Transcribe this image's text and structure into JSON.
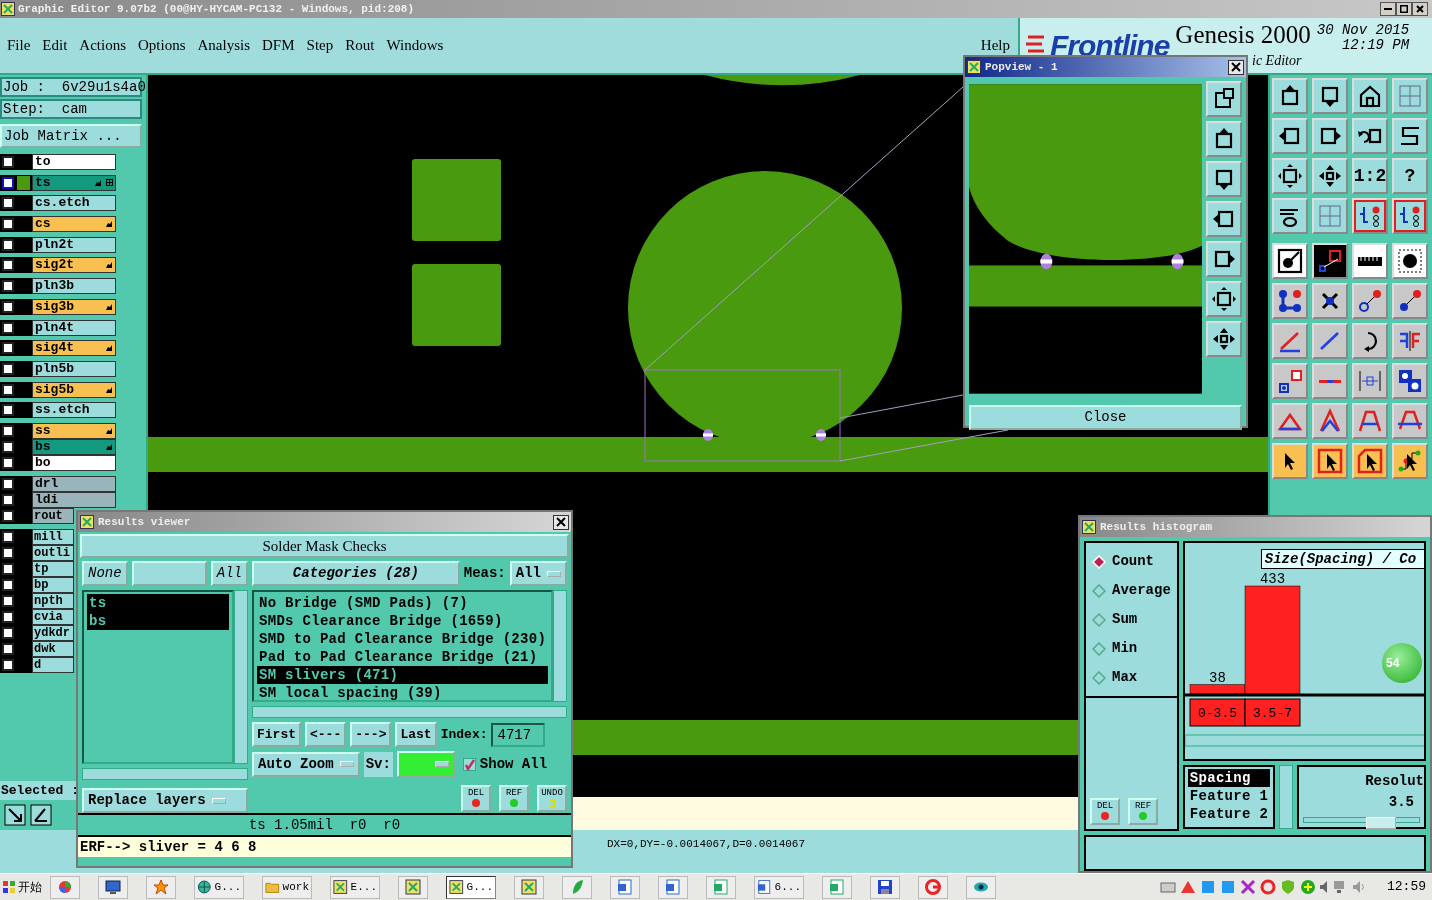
{
  "window": {
    "title": "Graphic Editor 9.07b2 (00@HY-HYCAM-PC132 - Windows, pid:208)"
  },
  "menu": [
    "File",
    "Edit",
    "Actions",
    "Options",
    "Analysis",
    "DFM",
    "Step",
    "Rout",
    "Windows"
  ],
  "help_menu": "Help",
  "brand": {
    "logo": "Frontline",
    "product": "Genesis 2000",
    "date": "30 Nov 2015",
    "time": "12:19 PM",
    "subtitle": "ic Editor"
  },
  "job": {
    "job": "Job :  6v29u1s4a0",
    "step": "Step:  cam",
    "matrix_button": "Job Matrix ..."
  },
  "layer_groups": [
    [
      {
        "name": "to",
        "color": "#ffffff",
        "affected": false,
        "work": false,
        "checked": false
      },
      {
        "name": "ts",
        "color": "#139a7e",
        "affected": true,
        "work": true,
        "checked": false
      },
      {
        "name": "cs.etch",
        "color": "#9ddcdc",
        "affected": false,
        "work": false,
        "checked": false
      },
      {
        "name": "cs",
        "color": "#f8c050",
        "affected": true,
        "work": false,
        "checked": false
      },
      {
        "name": "pln2t",
        "color": "#9ddcdc",
        "affected": false,
        "work": false,
        "checked": false
      },
      {
        "name": "sig2t",
        "color": "#f8c050",
        "affected": true,
        "work": false,
        "checked": false
      },
      {
        "name": "pln3b",
        "color": "#9ddcdc",
        "affected": false,
        "work": false,
        "checked": false
      },
      {
        "name": "sig3b",
        "color": "#f8c050",
        "affected": true,
        "work": false,
        "checked": false
      },
      {
        "name": "pln4t",
        "color": "#9ddcdc",
        "affected": false,
        "work": false,
        "checked": false
      },
      {
        "name": "sig4t",
        "color": "#f8c050",
        "affected": true,
        "work": false,
        "checked": false
      },
      {
        "name": "pln5b",
        "color": "#9ddcdc",
        "affected": false,
        "work": false,
        "checked": false
      },
      {
        "name": "sig5b",
        "color": "#f8c050",
        "affected": true,
        "work": false,
        "checked": false
      },
      {
        "name": "ss.etch",
        "color": "#9ddcdc",
        "affected": false,
        "work": false,
        "checked": false
      }
    ],
    [
      {
        "name": "ss",
        "color": "#f8c050",
        "affected": true,
        "work": false,
        "checked": false
      },
      {
        "name": "bs",
        "color": "#139a7e",
        "affected": true,
        "work": false,
        "checked": false
      },
      {
        "name": "bo",
        "color": "#ffffff",
        "affected": false,
        "work": false,
        "checked": false
      }
    ],
    [
      {
        "name": "drl",
        "color": "#9ab4bc",
        "affected": false,
        "work": false,
        "checked": false
      },
      {
        "name": "ldi",
        "color": "#9ab4bc",
        "affected": false,
        "work": false,
        "checked": false
      },
      {
        "name": "rout",
        "color": "#9ab4bc",
        "affected": false,
        "work": false,
        "checked": false
      }
    ],
    [
      {
        "name": "mill",
        "color": "#9ddcdc",
        "affected": false,
        "work": false,
        "checked": false
      },
      {
        "name": "outli",
        "color": "#9ddcdc",
        "affected": false,
        "work": false,
        "checked": false
      },
      {
        "name": "tp",
        "color": "#9ddcdc",
        "affected": false,
        "work": false,
        "checked": false
      },
      {
        "name": "bp",
        "color": "#9ddcdc",
        "affected": false,
        "work": false,
        "checked": false
      },
      {
        "name": "npth",
        "color": "#9ddcdc",
        "affected": false,
        "work": false,
        "checked": false
      },
      {
        "name": "cvia",
        "color": "#9ddcdc",
        "affected": false,
        "work": false,
        "checked": false
      },
      {
        "name": "ydkdr",
        "color": "#9ddcdc",
        "affected": false,
        "work": false,
        "checked": false
      },
      {
        "name": "dwk",
        "color": "#9ddcdc",
        "affected": false,
        "work": false,
        "checked": false
      },
      {
        "name": "d",
        "color": "#9ddcdc",
        "affected": false,
        "work": false,
        "checked": false
      }
    ]
  ],
  "selected_label": "Selected :",
  "toolbar_glyphs": [
    "1:2",
    "?"
  ],
  "status": "DX=0,DY=-0.0014067,D=0.0014067",
  "popview": {
    "title": "Popview - 1",
    "close": "Close"
  },
  "results_viewer": {
    "title": "Results viewer",
    "header": "Solder Mask Checks",
    "none_button": "None",
    "all_button": "All",
    "layers": [
      {
        "name": "ts",
        "selected": true
      },
      {
        "name": "bs",
        "selected": true
      }
    ],
    "categories_button": "Categories (28)",
    "meas_label": "Meas:",
    "meas_value": "All",
    "categories": [
      {
        "label": "No Bridge (SMD Pads) (7)",
        "selected": false
      },
      {
        "label": "SMDs Clearance Bridge (1659)",
        "selected": false
      },
      {
        "label": "SMD to Pad Clearance Bridge (230)",
        "selected": false
      },
      {
        "label": "Pad to Pad Clearance Bridge (21)",
        "selected": false
      },
      {
        "label": "SM slivers (471)",
        "selected": true
      },
      {
        "label": "SM local spacing (39)",
        "selected": false
      }
    ],
    "nav": [
      "First",
      "<---",
      "--->",
      "Last"
    ],
    "index_label": "Index:",
    "index_value": "4717",
    "zoom_mode": "Auto Zoom",
    "sv_label": "Sv:",
    "show_all": {
      "label": "Show All",
      "checked": true
    },
    "replace": "Replace layers",
    "actions": [
      {
        "label": "DEL",
        "kind": "delete"
      },
      {
        "label": "REF",
        "kind": "reference"
      },
      {
        "label": "UNDO",
        "kind": "undo"
      }
    ],
    "info": "ts 1.05mil  r0  r0",
    "erf": "ERF--> sliver = 4 6 8"
  },
  "histogram": {
    "title": "Results histogram",
    "modes": [
      {
        "label": "Count",
        "selected": true
      },
      {
        "label": "Average",
        "selected": false
      },
      {
        "label": "Sum",
        "selected": false
      },
      {
        "label": "Min",
        "selected": false
      },
      {
        "label": "Max",
        "selected": false
      }
    ],
    "chart_data": {
      "type": "bar",
      "title": "Size(Spacing) / Co",
      "categories": [
        "0-3.5",
        "3.5-7"
      ],
      "series": [
        {
          "color": "#ff2020",
          "values": [
            38,
            433
          ]
        }
      ],
      "data_labels": true
    },
    "fields": [
      {
        "label": "Spacing",
        "selected": true
      },
      {
        "label": "Feature 1",
        "selected": false
      },
      {
        "label": "Feature 2",
        "selected": false
      }
    ],
    "resolution": {
      "label": "Resolut",
      "value": "3.5",
      "level": 0.67
    },
    "actions": [
      {
        "label": "DEL",
        "kind": "delete"
      },
      {
        "label": "REF",
        "kind": "reference"
      }
    ],
    "badge": "54"
  },
  "taskbar": {
    "start": "开始",
    "items": [
      {
        "kind": "app",
        "selected": false
      },
      {
        "kind": "monitor",
        "selected": false
      },
      {
        "kind": "star",
        "selected": false
      },
      {
        "kind": "globe",
        "label": "G...",
        "selected": false
      },
      {
        "kind": "folder",
        "label": "work",
        "selected": false
      },
      {
        "kind": "window",
        "label": "E...",
        "selected": false
      },
      {
        "kind": "window",
        "selected": false
      },
      {
        "kind": "window",
        "label": "G...",
        "selected": true
      },
      {
        "kind": "window",
        "selected": false
      },
      {
        "kind": "leaf",
        "selected": false
      },
      {
        "kind": "document",
        "selected": false
      },
      {
        "kind": "document",
        "selected": false
      },
      {
        "kind": "sheet",
        "selected": false
      },
      {
        "kind": "document",
        "label": "6...",
        "selected": false
      },
      {
        "kind": "sheet",
        "selected": false
      },
      {
        "kind": "disk",
        "selected": false
      },
      {
        "kind": "swirl",
        "selected": false
      },
      {
        "kind": "eye",
        "selected": false
      }
    ],
    "clock": "12:59"
  }
}
